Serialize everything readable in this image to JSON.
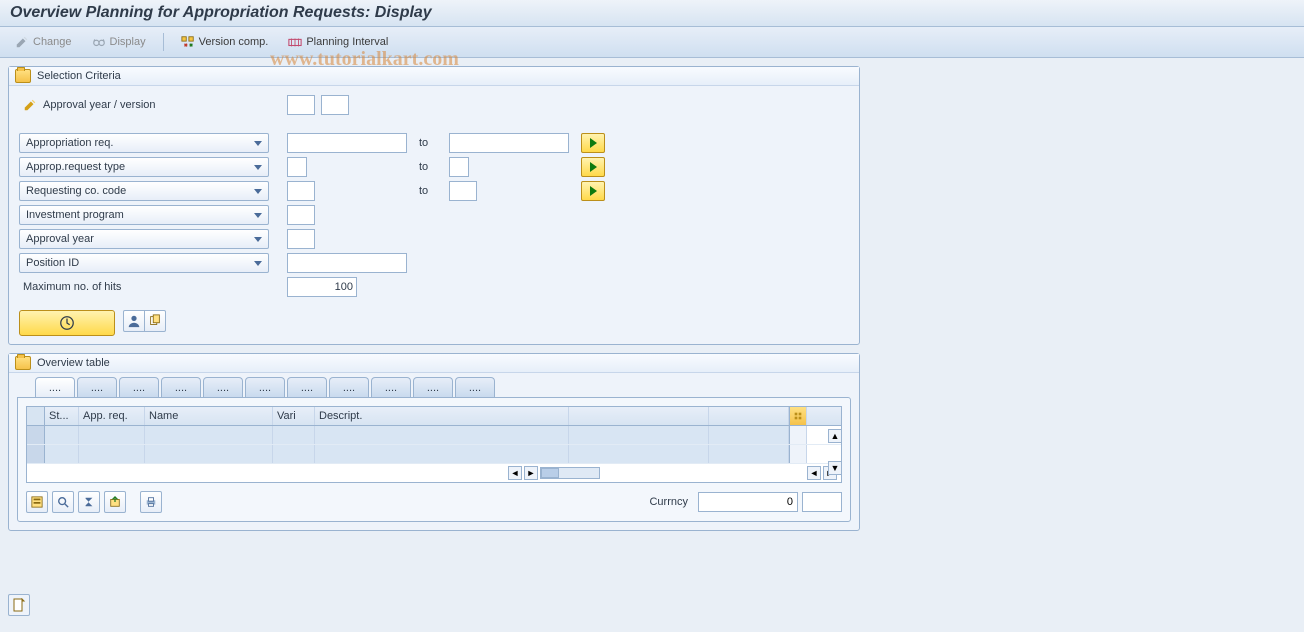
{
  "title": "Overview Planning for Appropriation Requests: Display",
  "watermark": "www.tutorialkart.com",
  "toolbar": {
    "change": "Change",
    "display": "Display",
    "version_comp": "Version comp.",
    "planning_interval": "Planning Interval"
  },
  "selection": {
    "title": "Selection Criteria",
    "approval_year_version_label": "Approval year / version",
    "approval_year_version_from": "",
    "approval_year_version_to": "",
    "rows": [
      {
        "id": "approp_req",
        "label": "Appropriation req.",
        "from": "",
        "to": "",
        "has_range": true,
        "from_w": "w120",
        "to_w": "w120"
      },
      {
        "id": "approp_req_type",
        "label": "Approp.request type",
        "from": "",
        "to": "",
        "has_range": true,
        "from_w": "w20",
        "to_w": "w20"
      },
      {
        "id": "req_co_code",
        "label": "Requesting co. code",
        "from": "",
        "to": "",
        "has_range": true,
        "from_w": "w30",
        "to_w": "w30"
      },
      {
        "id": "inv_program",
        "label": "Investment program",
        "from": "",
        "has_range": false,
        "from_w": "w30"
      },
      {
        "id": "approval_year",
        "label": "Approval year",
        "from": "",
        "has_range": false,
        "from_w": "w30"
      },
      {
        "id": "position_id",
        "label": "Position ID",
        "from": "",
        "has_range": false,
        "from_w": "w120"
      }
    ],
    "max_hits_label": "Maximum no. of hits",
    "max_hits_value": "100",
    "to_label": "to"
  },
  "overview": {
    "title": "Overview table",
    "tabs": [
      "....",
      "....",
      "....",
      "....",
      "....",
      "....",
      "....",
      "....",
      "....",
      "....",
      "...."
    ],
    "active_tab": 0,
    "columns": [
      "St...",
      "App. req.",
      "Name",
      "Vari",
      "Descript.",
      "",
      ""
    ],
    "rows": [
      [
        "",
        "",
        "",
        "",
        "",
        "",
        ""
      ],
      [
        "",
        "",
        "",
        "",
        "",
        "",
        ""
      ]
    ],
    "currency_label": "Currncy",
    "currency_value": "0",
    "currency_unit": ""
  }
}
